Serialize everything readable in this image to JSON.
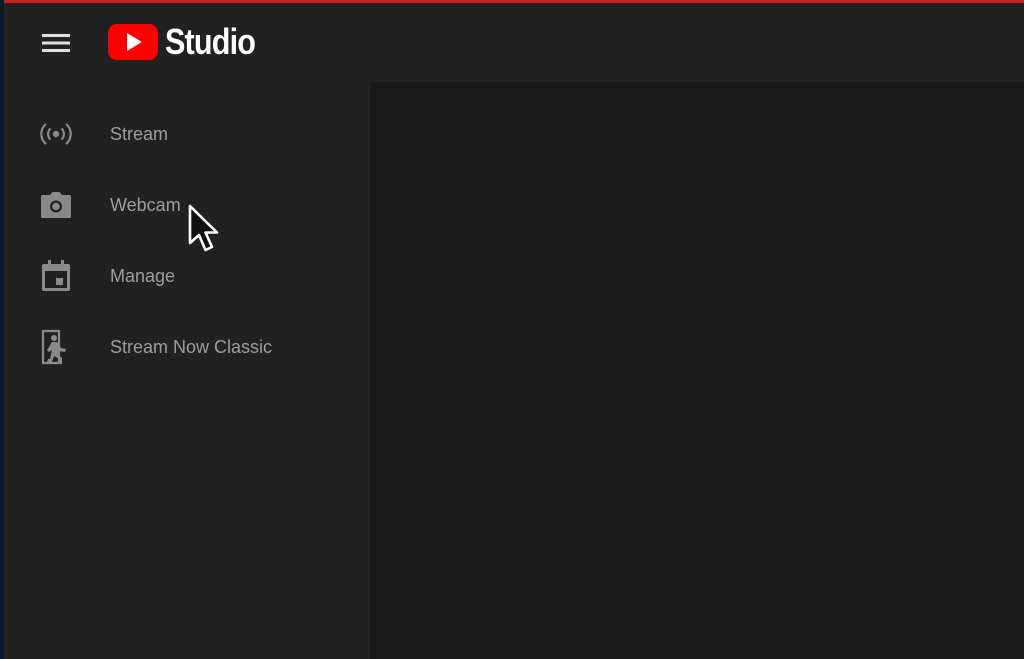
{
  "header": {
    "logo_text": "Studio"
  },
  "sidebar": {
    "items": [
      {
        "label": "Stream",
        "icon": "live-broadcast-icon"
      },
      {
        "label": "Webcam",
        "icon": "camera-icon"
      },
      {
        "label": "Manage",
        "icon": "calendar-icon"
      },
      {
        "label": "Stream Now Classic",
        "icon": "classic-exit-icon"
      }
    ]
  },
  "colors": {
    "accent": "#cc1f1f",
    "brand_red": "#ff0000",
    "background": "#212121",
    "main_background": "#181818",
    "nav_text": "#9e9e9e",
    "icon": "#8a8a8a"
  }
}
